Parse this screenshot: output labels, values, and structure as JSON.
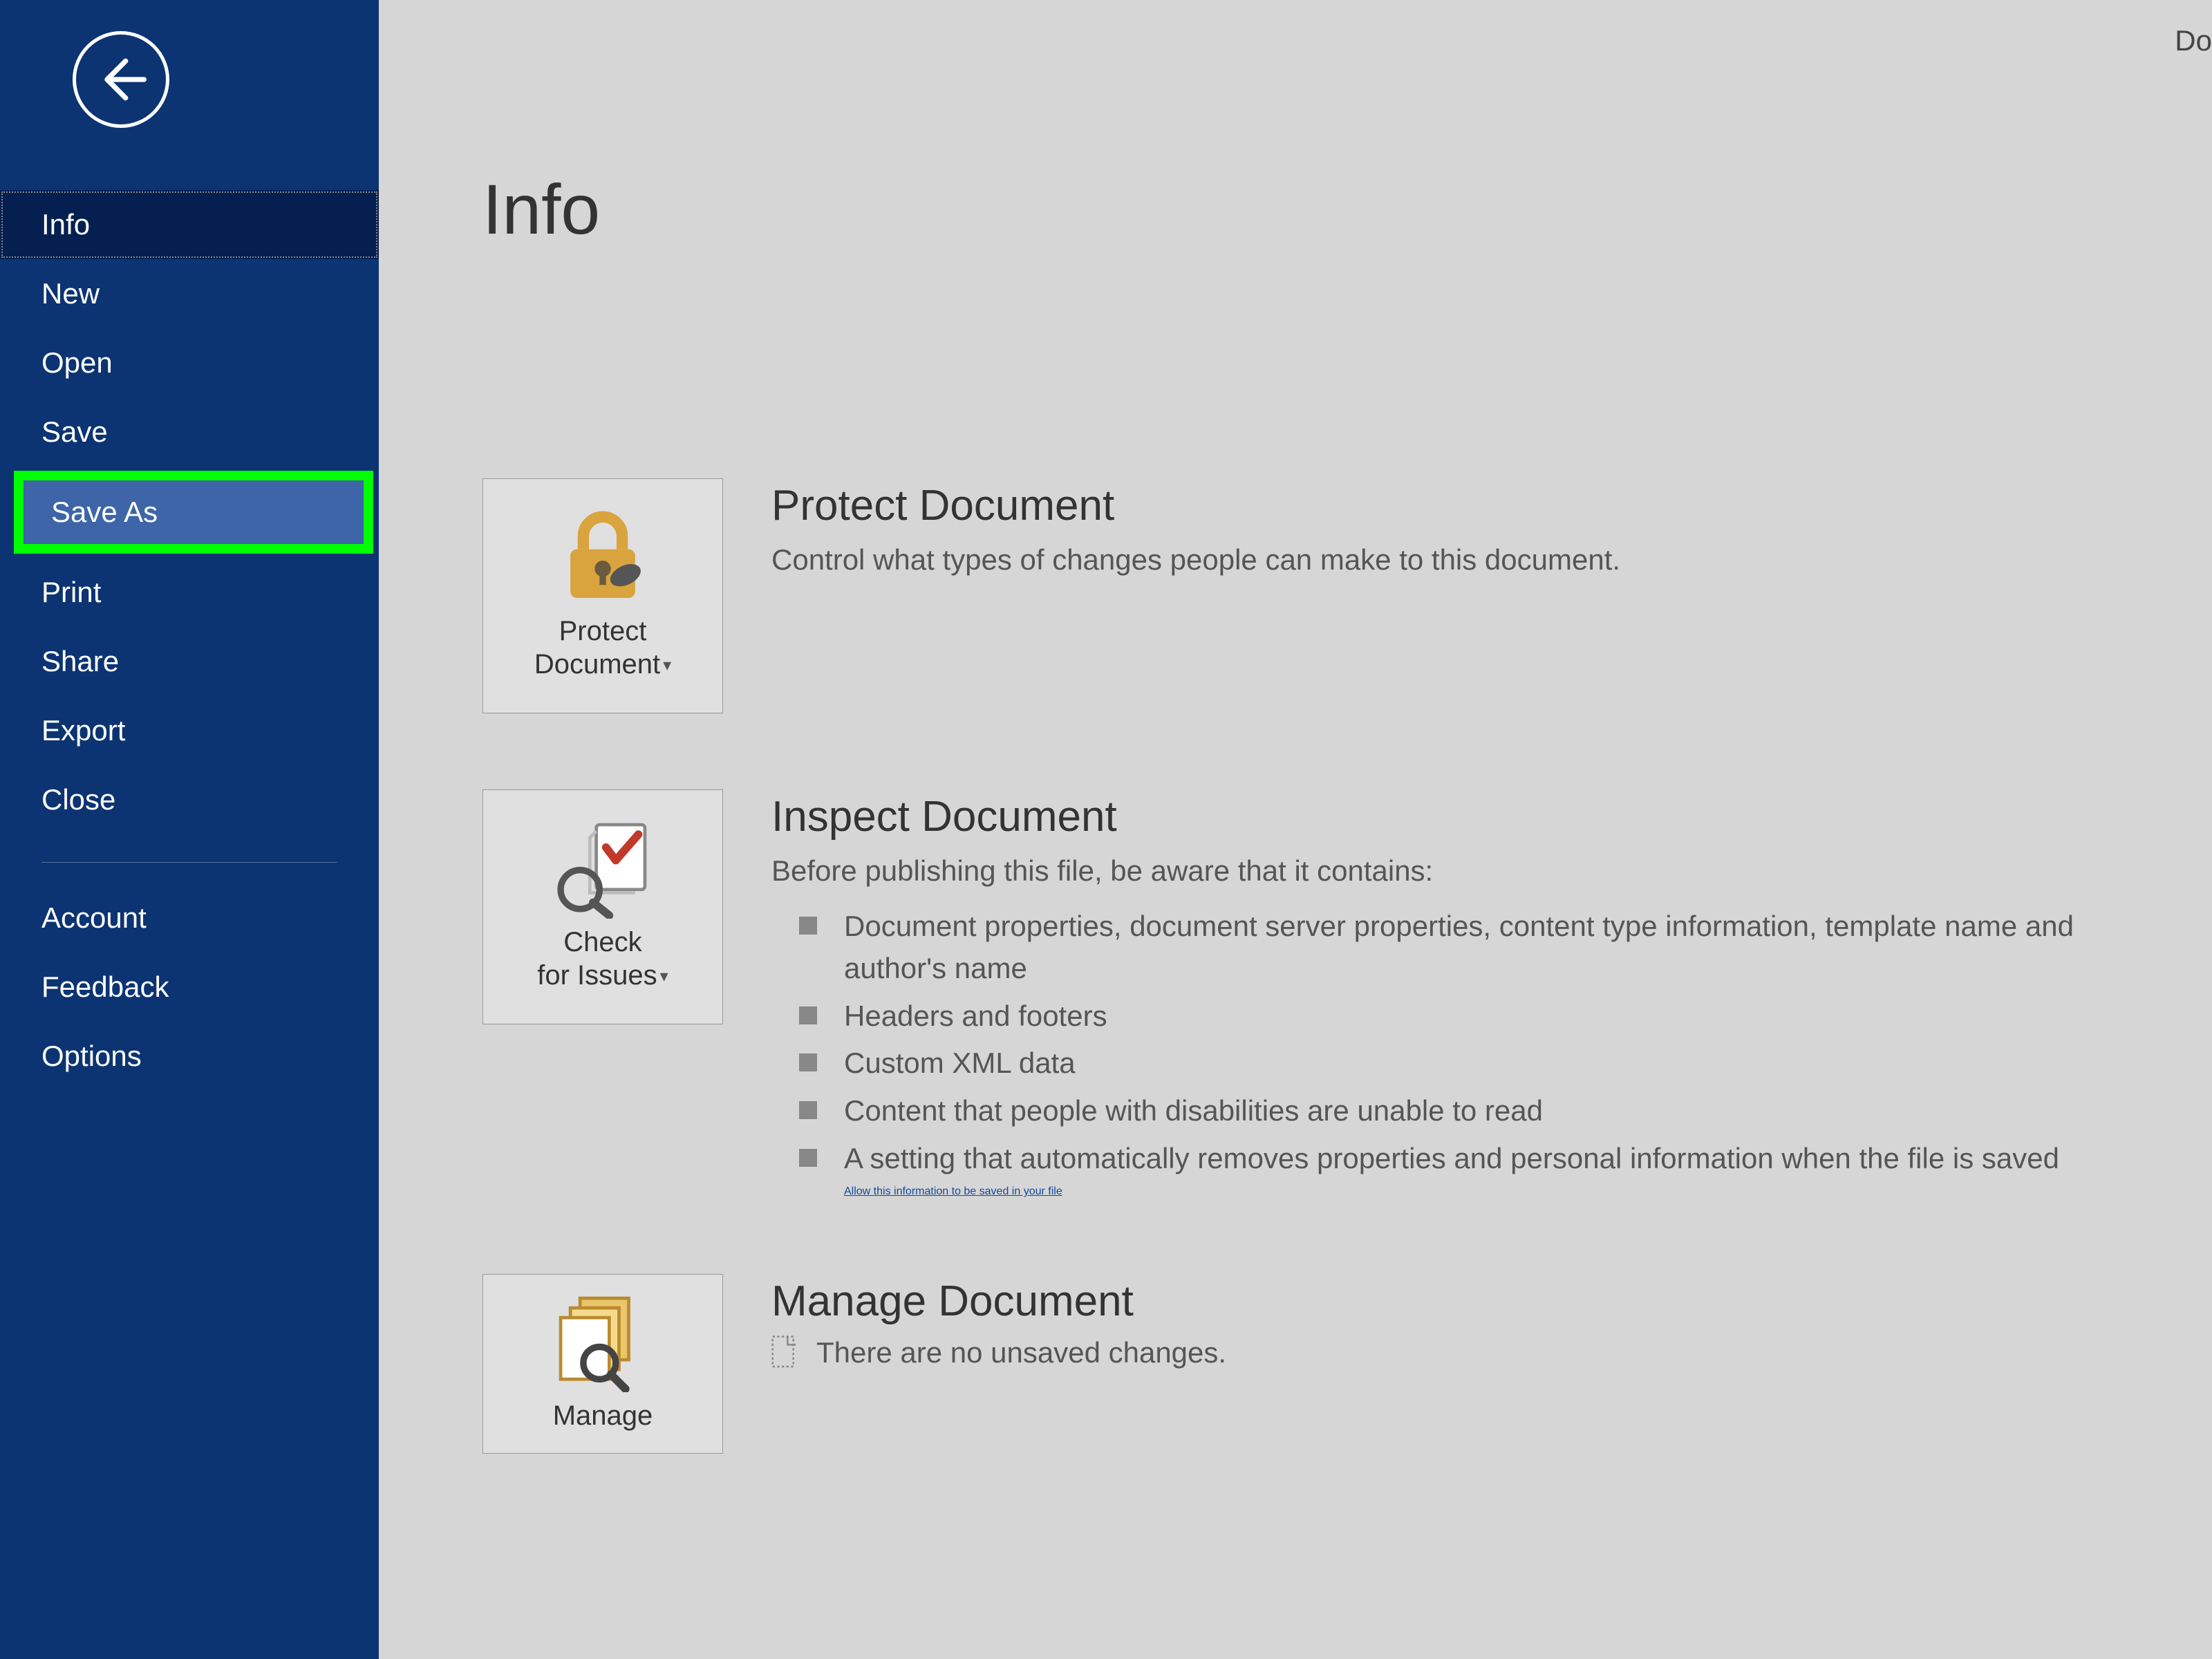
{
  "topright": "Do",
  "sidebar": {
    "items": [
      {
        "label": "Info",
        "state": "active"
      },
      {
        "label": "New",
        "state": ""
      },
      {
        "label": "Open",
        "state": ""
      },
      {
        "label": "Save",
        "state": ""
      },
      {
        "label": "Save As",
        "state": "highlight"
      },
      {
        "label": "Print",
        "state": ""
      },
      {
        "label": "Share",
        "state": ""
      },
      {
        "label": "Export",
        "state": ""
      },
      {
        "label": "Close",
        "state": ""
      }
    ],
    "lower": [
      {
        "label": "Account"
      },
      {
        "label": "Feedback"
      },
      {
        "label": "Options"
      }
    ]
  },
  "main": {
    "title": "Info",
    "protect": {
      "tile_label": "Protect Document",
      "title": "Protect Document",
      "desc": "Control what types of changes people can make to this document."
    },
    "inspect": {
      "tile_label": "Check for Issues",
      "title": "Inspect Document",
      "desc": "Before publishing this file, be aware that it contains:",
      "issues": [
        "Document properties, document server properties, content type information, template name and author's name",
        "Headers and footers",
        "Custom XML data",
        "Content that people with disabilities are unable to read",
        "A setting that automatically removes properties and personal information when the file is saved"
      ],
      "link": "Allow this information to be saved in your file"
    },
    "manage": {
      "tile_label": "Manage",
      "title": "Manage Document",
      "desc": "There are no unsaved changes."
    }
  }
}
